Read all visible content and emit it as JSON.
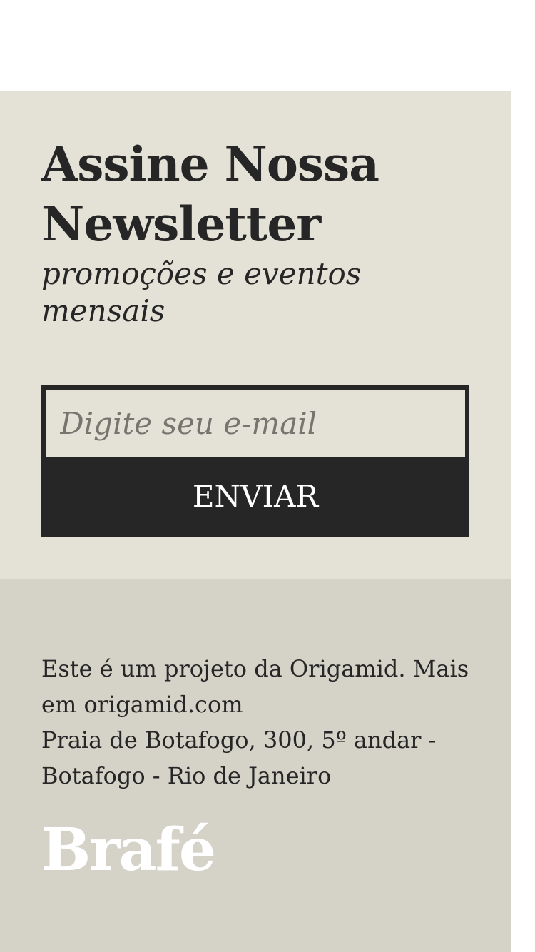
{
  "newsletter": {
    "title": "Assine Nossa Newsletter",
    "subtitle": "promoções e eventos mensais",
    "email_value": "",
    "email_placeholder": "Digite seu e-mail",
    "submit_label": "ENVIAR"
  },
  "footer": {
    "line_1": "Este é um projeto da Origamid. Mais em origamid.com",
    "line_2": "Praia de Botafogo, 300, 5º andar - Botafogo - Rio de Janeiro",
    "logo_text": "Brafé"
  },
  "colors": {
    "newsletter_bg": "#e4e2d6",
    "footer_bg": "#d5d3c8",
    "dark": "#262626",
    "logo": "#ffffff"
  }
}
